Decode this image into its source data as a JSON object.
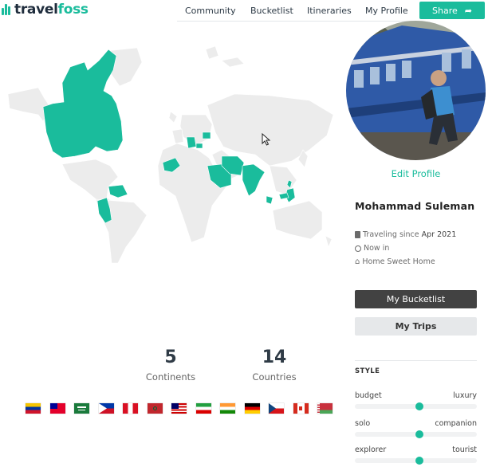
{
  "header": {
    "logo_prefix": "travel",
    "logo_suffix": "foss",
    "nav": [
      "Community",
      "Bucketlist",
      "Itineraries",
      "My Profile"
    ],
    "share_label": "Share"
  },
  "map": {
    "visited_color": "#1abc9c",
    "land_color": "#ececec",
    "border_color": "#ffffff"
  },
  "stats": {
    "continents_value": "5",
    "continents_label": "Continents",
    "countries_value": "14",
    "countries_label": "Countries"
  },
  "flags": [
    "Venezuela",
    "Taiwan",
    "Saudi Arabia",
    "Philippines",
    "Peru",
    "Morocco",
    "Malaysia",
    "Iran",
    "India",
    "Germany",
    "Czech Republic",
    "Canada",
    "Belarus"
  ],
  "profile": {
    "edit_label": "Edit Profile",
    "name": "Mohammad Suleman",
    "traveling_since_label": "Traveling since",
    "traveling_since_value": "Apr 2021",
    "now_in_label": "Now in",
    "home_label": "Home Sweet Home"
  },
  "actions": {
    "bucketlist_label": "My Bucketlist",
    "trips_label": "My Trips"
  },
  "style": {
    "heading": "STYLE",
    "sliders": [
      {
        "left": "budget",
        "right": "luxury",
        "value": 0.53
      },
      {
        "left": "solo",
        "right": "companion",
        "value": 0.53
      },
      {
        "left": "explorer",
        "right": "tourist",
        "value": 0.53
      }
    ]
  }
}
